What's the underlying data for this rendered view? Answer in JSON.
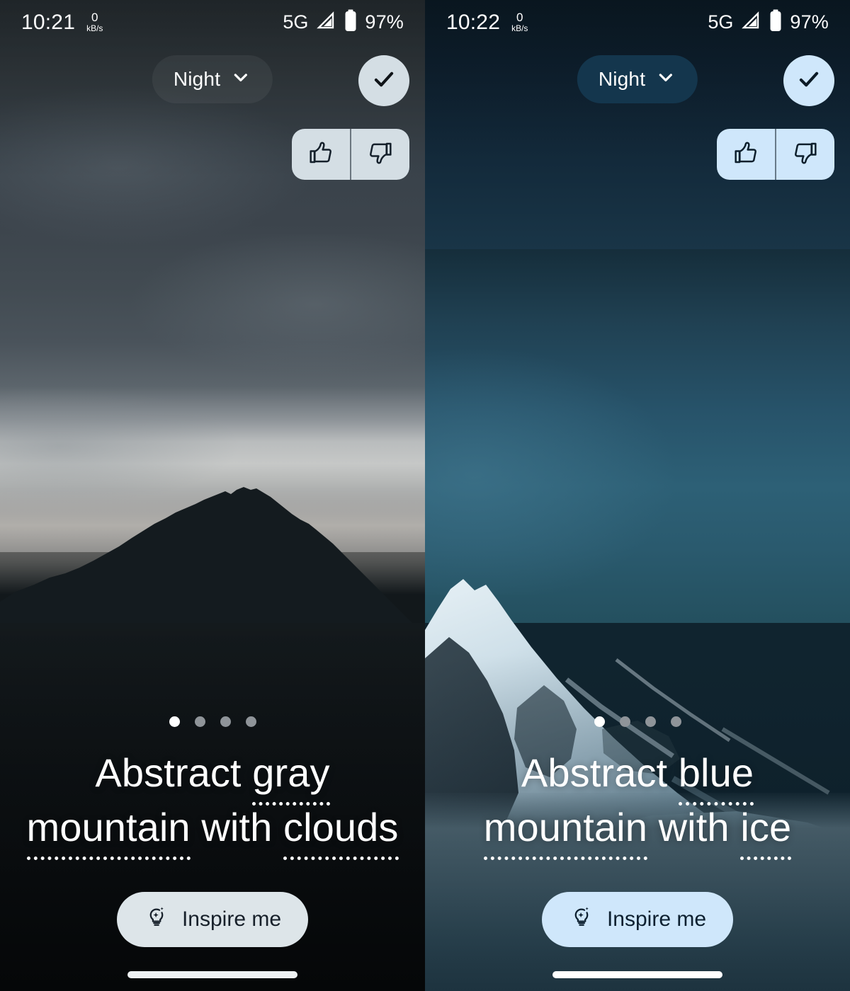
{
  "screens": [
    {
      "id": "left",
      "status_bar": {
        "time": "10:21",
        "net_speed_value": "0",
        "net_speed_unit": "kB/s",
        "network_type": "5G",
        "signal_icon": "signal-triangle-icon",
        "battery_icon": "battery-icon",
        "battery_percent": "97%"
      },
      "top_bar": {
        "style_chip_label": "Night",
        "style_chip_icon": "chevron-down-icon",
        "confirm_icon": "check-icon",
        "thumbs_up_icon": "thumb-up-icon",
        "thumbs_down_icon": "thumb-down-icon"
      },
      "pagination": {
        "total": 4,
        "active_index": 0
      },
      "caption": {
        "full_text": "Abstract gray mountain with clouds",
        "line1": [
          {
            "text": "Abstract",
            "editable": false
          },
          {
            "text": "gray",
            "editable": true
          }
        ],
        "line2": [
          {
            "text": "mountain",
            "editable": true
          },
          {
            "text": "with",
            "editable": false
          },
          {
            "text": "clouds",
            "editable": true
          }
        ]
      },
      "inspire_button": {
        "label": "Inspire me",
        "icon": "lightbulb-sparkle-icon"
      },
      "nav_pill": "home-gesture-pill",
      "colors": {
        "chip_bg": "#1c2428",
        "accent_button_bg": "#d4dee4",
        "inspire_bg": "#dde5e9",
        "wallpaper_base": "#12181b"
      }
    },
    {
      "id": "right",
      "status_bar": {
        "time": "10:22",
        "net_speed_value": "0",
        "net_speed_unit": "kB/s",
        "network_type": "5G",
        "signal_icon": "signal-triangle-icon",
        "battery_icon": "battery-icon",
        "battery_percent": "97%"
      },
      "top_bar": {
        "style_chip_label": "Night",
        "style_chip_icon": "chevron-down-icon",
        "confirm_icon": "check-icon",
        "thumbs_up_icon": "thumb-up-icon",
        "thumbs_down_icon": "thumb-down-icon"
      },
      "pagination": {
        "total": 4,
        "active_index": 0
      },
      "caption": {
        "full_text": "Abstract blue mountain with ice",
        "line1": [
          {
            "text": "Abstract",
            "editable": false
          },
          {
            "text": "blue",
            "editable": true
          }
        ],
        "line2": [
          {
            "text": "mountain",
            "editable": true
          },
          {
            "text": "with",
            "editable": false
          },
          {
            "text": "ice",
            "editable": true
          }
        ]
      },
      "inspire_button": {
        "label": "Inspire me",
        "icon": "lightbulb-sparkle-icon"
      },
      "nav_pill": "home-gesture-pill",
      "colors": {
        "chip_bg": "#14364d",
        "accent_button_bg": "#cfe7fb",
        "inspire_bg": "#cfe7fb",
        "wallpaper_base": "#10242f"
      }
    }
  ]
}
